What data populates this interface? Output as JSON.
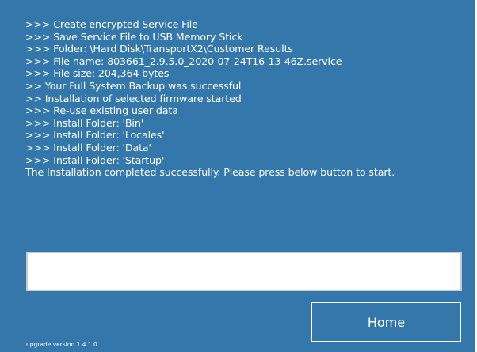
{
  "log": {
    "lines": [
      ">>> Create encrypted Service File",
      ">>> Save Service File to USB Memory Stick",
      ">>> Folder: \\Hard Disk\\TransportX2\\Customer Results",
      ">>> File name: 803661_2.9.5.0_2020-07-24T16-13-46Z.service",
      ">>> File size: 204,364 bytes",
      ">> Your Full System Backup was successful",
      ">> Installation of selected firmware started",
      ">>> Re-use existing user data",
      ">>> Install Folder: 'Bin'",
      ">>> Install Folder: 'Locales'",
      ">>> Install Folder: 'Data'",
      ">>> Install Folder: 'Startup'",
      "The Installation completed successfully. Please press below button to start."
    ]
  },
  "progress": {
    "value": 0
  },
  "buttons": {
    "home_label": "Home"
  },
  "footer": {
    "version_text": "upgrade version 1.4.1.0"
  },
  "colors": {
    "background": "#3478ab",
    "text": "#ffffff"
  }
}
